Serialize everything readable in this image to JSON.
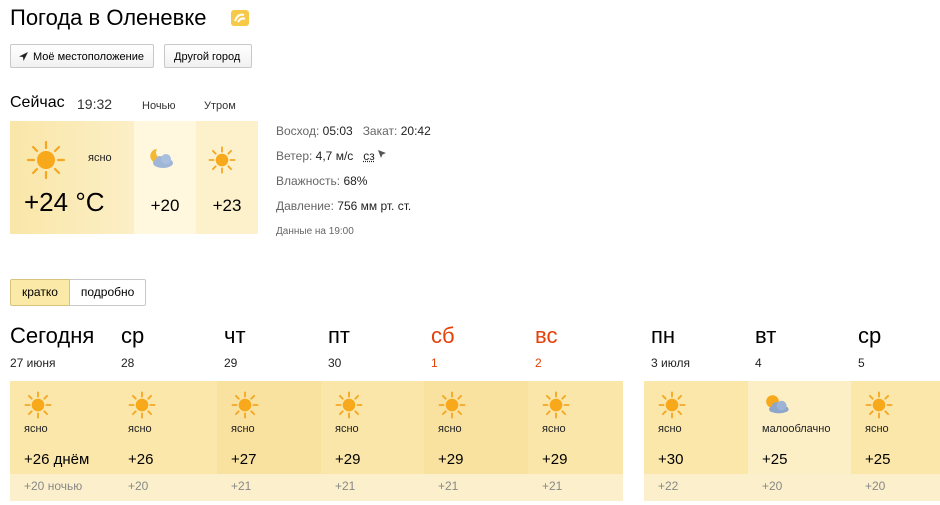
{
  "header": {
    "title": "Погода в Оленевке"
  },
  "buttons": {
    "my_location": "Моё местоположение",
    "other_city": "Другой город"
  },
  "now": {
    "label": "Сейчас",
    "time": "19:32",
    "night_caption": "Ночью",
    "morning_caption": "Утром",
    "condition": "ясно",
    "temp": "+24 °C",
    "night_temp": "+20",
    "morning_temp": "+23"
  },
  "details": {
    "sunrise_label": "Восход:",
    "sunrise": "05:03",
    "sunset_label": "Закат:",
    "sunset": "20:42",
    "wind_label": "Ветер:",
    "wind": "4,7 м/с",
    "wind_dir": "сз",
    "humidity_label": "Влажность:",
    "humidity": "68%",
    "pressure_label": "Давление:",
    "pressure": "756 мм рт. ст.",
    "data_note": "Данные на 19:00"
  },
  "toggle": {
    "short": "кратко",
    "detailed": "подробно"
  },
  "forecast": [
    {
      "name": "Сегодня",
      "date": "27 июня",
      "cond": "ясно",
      "icon": "sun-icon",
      "day": "+26 днём",
      "night": "+20 ночью",
      "weekend": false
    },
    {
      "name": "ср",
      "date": "28",
      "cond": "ясно",
      "icon": "sun-icon",
      "day": "+26",
      "night": "+20",
      "weekend": false
    },
    {
      "name": "чт",
      "date": "29",
      "cond": "ясно",
      "icon": "sun-icon",
      "day": "+27",
      "night": "+21",
      "weekend": false
    },
    {
      "name": "пт",
      "date": "30",
      "cond": "ясно",
      "icon": "sun-icon",
      "day": "+29",
      "night": "+21",
      "weekend": false
    },
    {
      "name": "сб",
      "date": "1",
      "cond": "ясно",
      "icon": "sun-icon",
      "day": "+29",
      "night": "+21",
      "weekend": true
    },
    {
      "name": "вс",
      "date": "2",
      "cond": "ясно",
      "icon": "sun-icon",
      "day": "+29",
      "night": "+21",
      "weekend": true
    },
    {
      "name": "пн",
      "date": "3 июля",
      "cond": "ясно",
      "icon": "sun-icon",
      "day": "+30",
      "night": "+22",
      "weekend": false
    },
    {
      "name": "вт",
      "date": "4",
      "cond": "малооблачно",
      "icon": "partly-cloudy-icon",
      "day": "+25",
      "night": "+20",
      "weekend": false
    },
    {
      "name": "ср",
      "date": "5",
      "cond": "ясно",
      "icon": "sun-icon",
      "day": "+25",
      "night": "+20",
      "weekend": false
    }
  ],
  "colors": {
    "weekend": "#e6400a",
    "accent": "#fbe9a8",
    "sun": "#f5a623"
  }
}
